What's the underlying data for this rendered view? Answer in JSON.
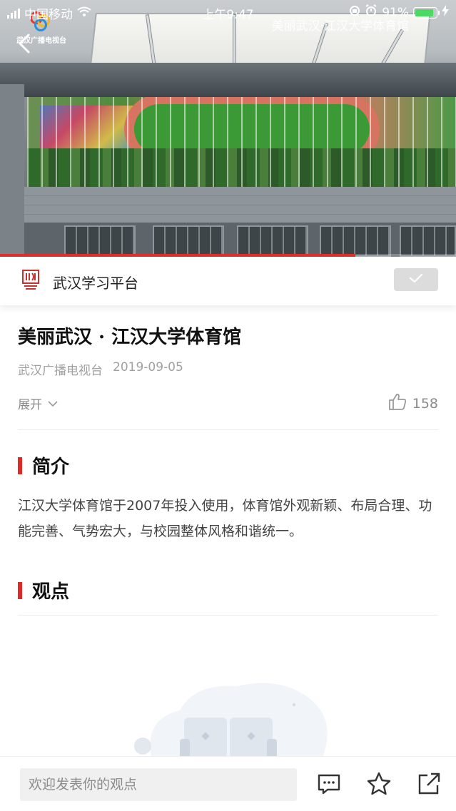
{
  "status_bar": {
    "carrier": "中国移动",
    "time": "上午9:47",
    "battery": "91%",
    "battery_level": 0.91
  },
  "video": {
    "channel_logo_text": "武汉广播电视台",
    "overlay_title": "美丽武汉·江汉大学体育馆",
    "progress": 0.78,
    "icons": [
      "back-arrow-icon"
    ]
  },
  "platform": {
    "name": "武汉学习平台",
    "subscribed": true,
    "icons": [
      "platform-logo-icon",
      "check-icon"
    ]
  },
  "article": {
    "title": "美丽武汉 · 江汉大学体育馆",
    "source": "武汉广播电视台",
    "date": "2019-09-05",
    "expand_label": "展开",
    "like_count": "158"
  },
  "sections": {
    "intro_heading": "简介",
    "intro_text": "江汉大学体育馆于2007年投入使用，体育馆外观新颖、布局合理、功能完善、气势宏大，与校园整体风格和谐统一。",
    "opinion_heading": "观点"
  },
  "bottom_bar": {
    "comment_placeholder": "欢迎发表你的观点",
    "icons": [
      "comment-icon",
      "star-icon",
      "share-icon"
    ]
  },
  "colors": {
    "accent_red": "#e02a25",
    "battery_green": "#4cd964",
    "muted_text": "#a0a0a0"
  }
}
